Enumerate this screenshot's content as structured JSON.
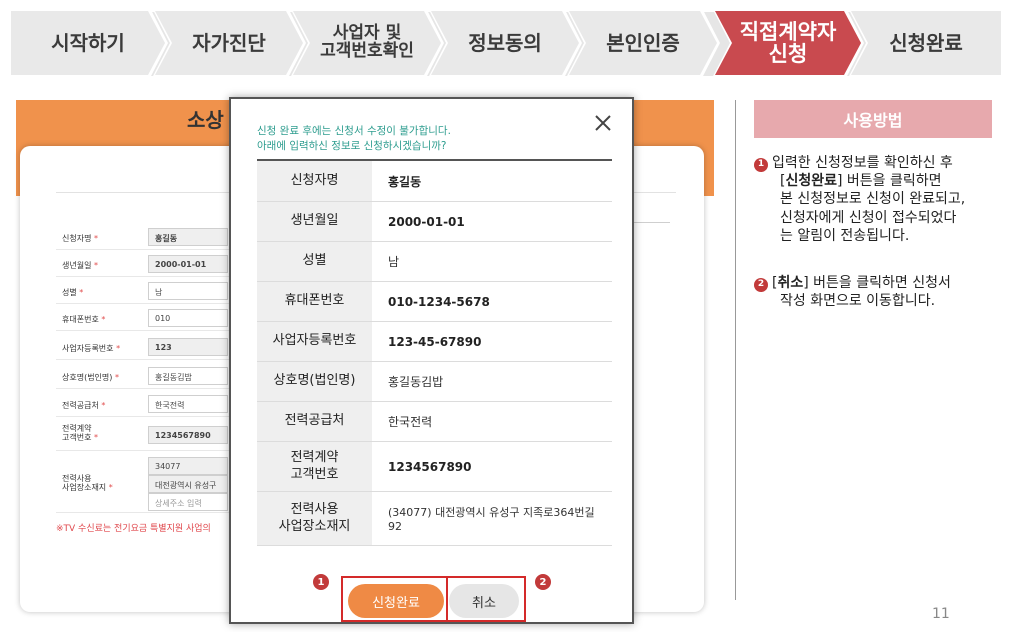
{
  "steps": [
    {
      "line1": "시작하기",
      "line2": ""
    },
    {
      "line1": "자가진단",
      "line2": ""
    },
    {
      "line1": "사업자 및",
      "line2": "고객번호확인"
    },
    {
      "line1": "정보동의",
      "line2": ""
    },
    {
      "line1": "본인인증",
      "line2": ""
    },
    {
      "line1": "직접계약자",
      "line2": "신청"
    },
    {
      "line1": "신청완료",
      "line2": ""
    }
  ],
  "background": {
    "title": "소상",
    "required_mark": "*",
    "rows": [
      {
        "label": "신청자명",
        "value": "홍길동"
      },
      {
        "label": "생년월일",
        "value": "2000-01-01"
      },
      {
        "label": "성별",
        "value": "남"
      },
      {
        "label": "휴대폰번호",
        "value": "010"
      },
      {
        "label": "사업자등록번호",
        "value": "123"
      },
      {
        "label": "상호명(법인명)",
        "value": "홍길동김밥"
      },
      {
        "label": "전력공급처",
        "value": "한국전력"
      },
      {
        "label_line1": "전력계약",
        "label_line2": "고객번호",
        "value": "1234567890"
      },
      {
        "label_line1": "전력사용",
        "label_line2": "사업장소재지",
        "zip": "34077",
        "addr": "대전광역시 유성구",
        "detail_placeholder": "상세주소 입력"
      }
    ],
    "notice": "※TV 수신료는 전기요금 특별지원 사업의"
  },
  "modal": {
    "message_line1": "신청 완료 후에는 신청서 수정이 불가합니다.",
    "message_line2": "아래에 입력하신 정보로 신청하시겠습니까?",
    "close_icon": "close-icon",
    "rows": [
      {
        "label": "신청자명",
        "value": "홍길동"
      },
      {
        "label": "생년월일",
        "value": "2000-01-01"
      },
      {
        "label": "성별",
        "value": "남"
      },
      {
        "label": "휴대폰번호",
        "value": "010-1234-5678"
      },
      {
        "label": "사업자등록번호",
        "value": "123-45-67890"
      },
      {
        "label": "상호명(법인명)",
        "value": "홍길동김밥"
      },
      {
        "label": "전력공급처",
        "value": "한국전력"
      },
      {
        "label_line1": "전력계약",
        "label_line2": "고객번호",
        "value": "1234567890"
      },
      {
        "label_line1": "전력사용",
        "label_line2": "사업장소재지",
        "value": "(34077) 대전광역시 유성구 지족로364번길 92"
      }
    ],
    "submit_label": "신청완료",
    "cancel_label": "취소",
    "badge1": "1",
    "badge2": "2"
  },
  "guide": {
    "title": "사용방법",
    "item1_num": "1",
    "item1_a": "입력한 신청정보를 확인하신 후",
    "item1_bracket_open": "[",
    "item1_bold": "신청완료",
    "item1_b": "] 버튼을 클릭하면",
    "item1_c": "본 신청정보로 신청이 완료되고,",
    "item1_d": "신청자에게 신청이 접수되었다",
    "item1_e": "는 알림이 전송됩니다.",
    "item2_num": "2",
    "item2_bracket_open": "[",
    "item2_bold": "취소",
    "item2_a": "] 버튼을 클릭하면 신청서",
    "item2_b": "작성 화면으로 이동합니다."
  },
  "page_number": "11",
  "colors": {
    "active_step": "#c94a4f",
    "header_orange": "#f0924c",
    "submit_orange": "#ef8a45",
    "message_teal": "#2e9d8f",
    "highlight_red": "#d42a2a",
    "guide_pink": "#e7a9ad"
  }
}
